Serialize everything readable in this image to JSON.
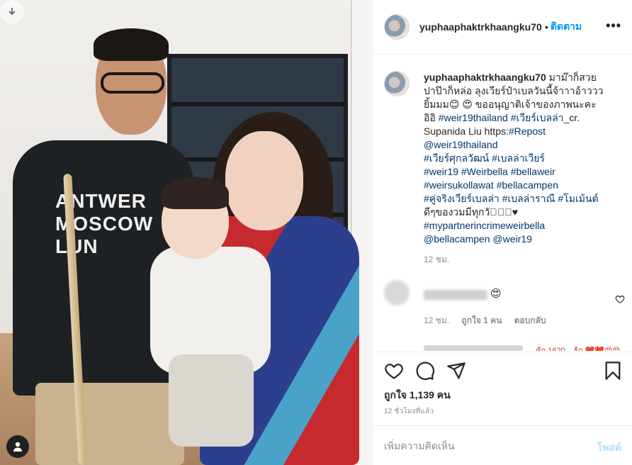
{
  "header": {
    "username": "yuphaaphaktrkhaangku70",
    "dot": "•",
    "follow_label": "ติดตาม",
    "more_label": "•••"
  },
  "photo": {
    "shirt_text": "ANTWER\nMOSCOW\nLUN"
  },
  "caption": {
    "username": "yuphaaphaktrkhaangku70",
    "text_parts": [
      {
        "t": "มาม๊าก็สวย\nปาป๊าก็หล่อ ลุงเวียร์ป๋าเบลวันนี้จ้าาาอ้าววว\nยิ้มมม😊 😍 ขออนุญาติเจ้าของภาพนะคะ\nอิอิ ",
        "tag": false
      },
      {
        "t": "#weir19thailand",
        "tag": true
      },
      {
        "t": " ",
        "tag": false
      },
      {
        "t": "#เวียร์เบลล่า",
        "tag": true
      },
      {
        "t": "_cr.\nSupanida Liu https:",
        "tag": false
      },
      {
        "t": "#Repost",
        "tag": true
      },
      {
        "t": "\n",
        "tag": false
      },
      {
        "t": "@weir19thailand",
        "tag": true
      },
      {
        "t": "\n",
        "tag": false
      },
      {
        "t": "#เวียร์ศุกลวัฒน์",
        "tag": true
      },
      {
        "t": " ",
        "tag": false
      },
      {
        "t": "#เบลล่าเวียร์",
        "tag": true
      },
      {
        "t": "\n",
        "tag": false
      },
      {
        "t": "#weir19",
        "tag": true
      },
      {
        "t": " ",
        "tag": false
      },
      {
        "t": "#Weirbella",
        "tag": true
      },
      {
        "t": " ",
        "tag": false
      },
      {
        "t": "#bellaweir",
        "tag": true
      },
      {
        "t": "\n",
        "tag": false
      },
      {
        "t": "#weirsukollawat",
        "tag": true
      },
      {
        "t": " ",
        "tag": false
      },
      {
        "t": "#bellacampen",
        "tag": true
      },
      {
        "t": "\n",
        "tag": false
      },
      {
        "t": "#คู่จริงเวียร์เบลล่า",
        "tag": true
      },
      {
        "t": " ",
        "tag": false
      },
      {
        "t": "#เบลล่าราณี",
        "tag": true
      },
      {
        "t": " ",
        "tag": false
      },
      {
        "t": "#โมเม้นต์",
        "tag": true
      },
      {
        "t": "\nดีๆของวมมีทุกวัน🏻🏽♥\n",
        "tag": false
      },
      {
        "t": "#mypartnerincrimeweirbella",
        "tag": true
      },
      {
        "t": "\n",
        "tag": false
      },
      {
        "t": "@bellacampen",
        "tag": true
      },
      {
        "t": " ",
        "tag": false
      },
      {
        "t": "@weir19",
        "tag": true
      }
    ],
    "time": "12 ชม."
  },
  "comment": {
    "emoji": "😍",
    "time": "12 ชม.",
    "likes": "ถูกใจ 1 คน",
    "reply": "ตอบกลับ"
  },
  "next_comment_peek": {
    "text": "...คัก 1620 ...ร้ก ❤️❤️😍😍"
  },
  "actions": {
    "likes": "ถูกใจ 1,139 คน",
    "ago": "12 ชั่วโมงที่แล้ว"
  },
  "add_comment": {
    "placeholder": "เพิ่มความคิดเห็น",
    "post_label": "โพสต์"
  },
  "colors": {
    "accent": "#0095f6",
    "tag": "#00376b",
    "post_disabled": "#b2dffc",
    "muted": "#8e8e8e"
  },
  "icons": [
    "download-icon",
    "user-tag-icon",
    "more-icon",
    "heart-icon",
    "comment-icon",
    "share-icon",
    "bookmark-icon"
  ]
}
